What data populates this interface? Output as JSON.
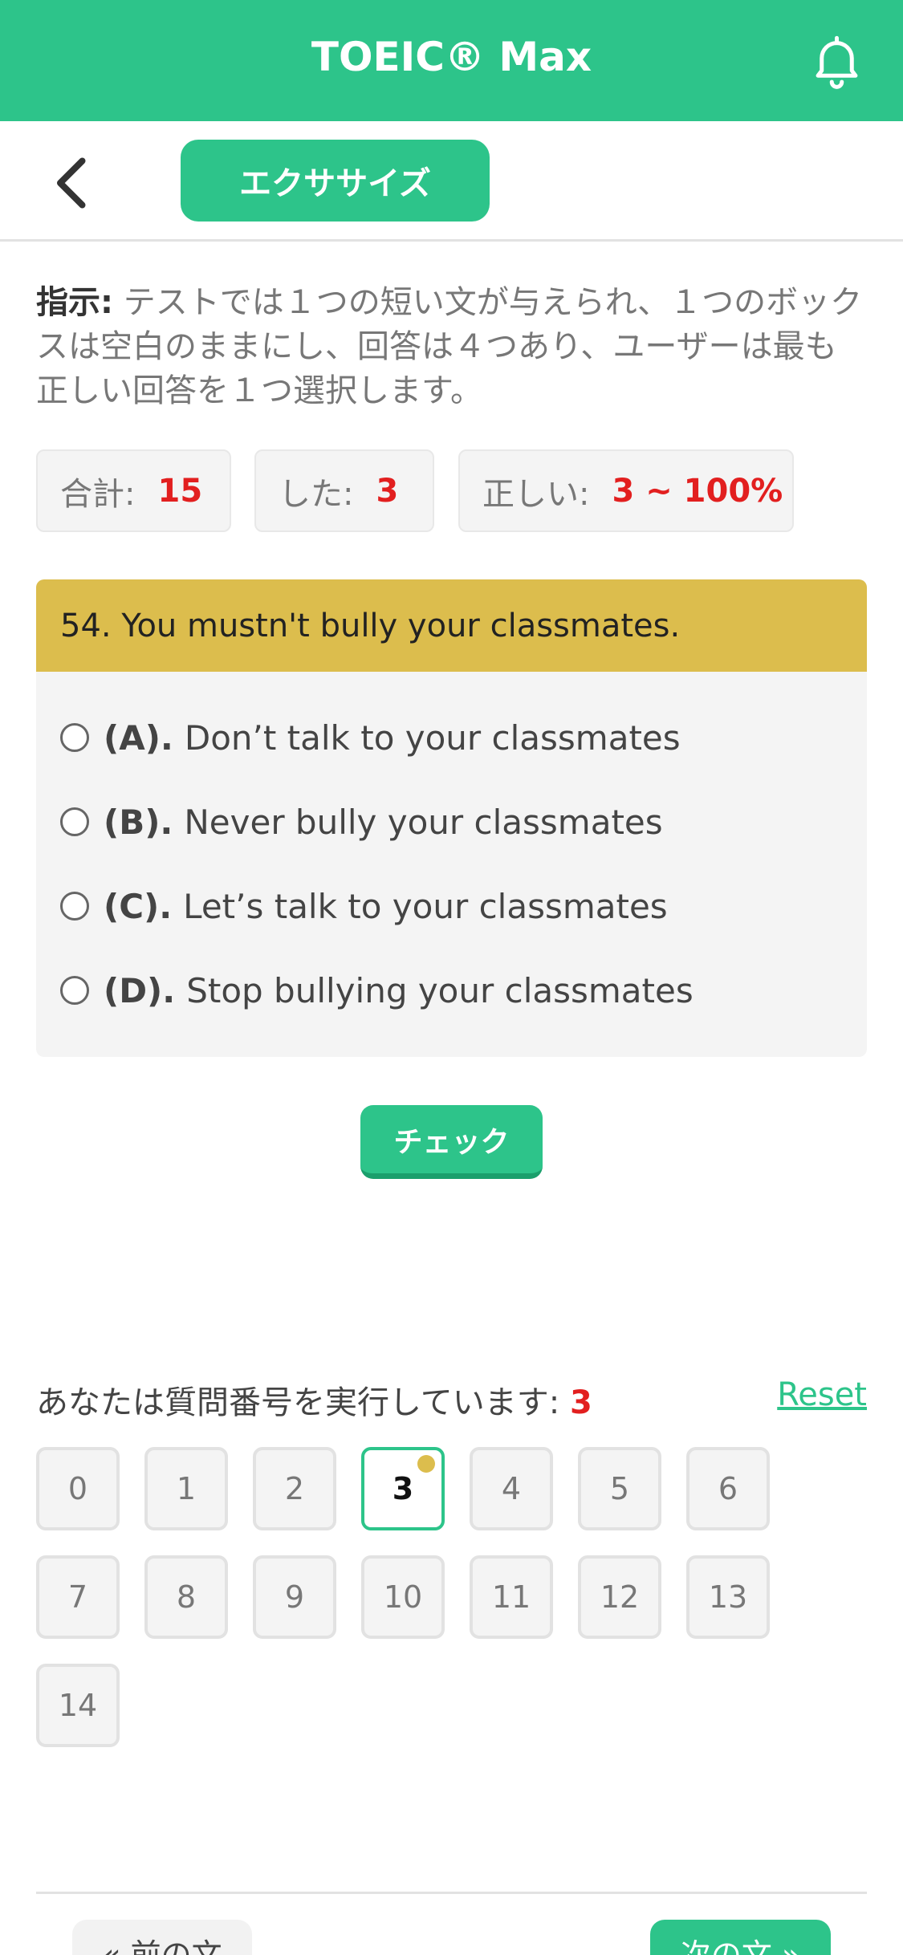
{
  "header": {
    "title": "TOEIC® Max"
  },
  "subbar": {
    "tab_label": "エクササイズ"
  },
  "instruction": {
    "label": "指示:",
    "text": " テストでは１つの短い文が与えられ、１つのボックスは空白のままにし、回答は４つあり、ユーザーは最も正しい回答を１つ選択します。"
  },
  "stats": {
    "total_label": "合計:",
    "total_value": "15",
    "done_label": "した:",
    "done_value": "3",
    "correct_label": "正しい:",
    "correct_value": "3 ~ 100%"
  },
  "question": {
    "text": "54. You mustn't bully your classmates.",
    "options": [
      {
        "letter": "(A).",
        "text": "Don’t talk to your classmates"
      },
      {
        "letter": "(B).",
        "text": "Never bully your classmates"
      },
      {
        "letter": "(C).",
        "text": "Let’s talk to your classmates"
      },
      {
        "letter": "(D).",
        "text": "Stop bullying your classmates"
      }
    ]
  },
  "check_label": "チェック",
  "progress": {
    "text": "あなたは質問番号を実行しています: ",
    "current": "3",
    "reset_label": "Reset"
  },
  "question_numbers": [
    "0",
    "1",
    "2",
    "3",
    "4",
    "5",
    "6",
    "7",
    "8",
    "9",
    "10",
    "11",
    "12",
    "13",
    "14"
  ],
  "navigation": {
    "prev_label": "« 前の文",
    "next_label": "次の文 »"
  },
  "colors": {
    "accent": "#2dc48a",
    "question_header": "#dcbd4d",
    "highlight": "#e21f1f"
  }
}
